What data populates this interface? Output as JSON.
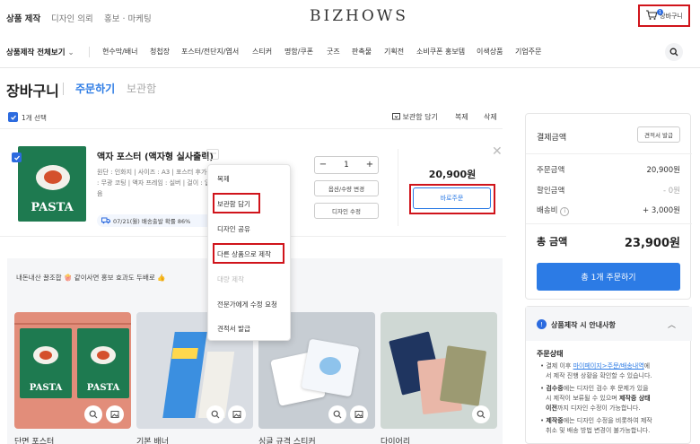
{
  "top_nav": {
    "links": [
      "상품 제작",
      "디자인 의뢰",
      "홍보 · 마케팅"
    ],
    "logo": "BIZHOWS",
    "cart_label": "장바구니",
    "cart_count": "1"
  },
  "category_nav": {
    "all_label": "상품제작 전체보기",
    "items": [
      "현수막/배너",
      "청첩장",
      "포스터/전단지/엽서",
      "스티커",
      "명함/쿠폰",
      "굿즈",
      "판촉물",
      "기획전",
      "소비쿠폰 홍보템",
      "이색상품",
      "기업주문"
    ]
  },
  "page": {
    "title": "장바구니",
    "tabs": [
      "주문하기",
      "보관함"
    ]
  },
  "selection": {
    "label": "1개 선택",
    "actions": [
      "보관함 담기",
      "복제",
      "삭제"
    ]
  },
  "cart_item": {
    "name": "액자 포스터 (액자형 실사출력)",
    "more": "···",
    "options": "원단 : 인화지 | 사이즈 : A3 | 포스터 후가공 : 무광 코팅 | 액자 프레임 : 실버 | 걸이 : 없음",
    "thumb_text": "PASTA",
    "shipping": "07/21(월) 배송출발 확률 86%",
    "quantity": "1",
    "qty_minus": "−",
    "qty_plus": "+",
    "btn_change": "옵션/수량 변경",
    "btn_edit": "디자인 수정",
    "price": "20,900원",
    "buy_now": "바로주문",
    "close": "✕"
  },
  "dropdown_menu": {
    "items": [
      "복제",
      "보관함 담기",
      "디자인 공유",
      "다른 상품으로 제작",
      "대량 제작",
      "전문가에게 수정 요청",
      "견적서 발급"
    ]
  },
  "promo": {
    "text": "내돈내산 꿀조합 🍿 같이사면 홍보 효과도 두배로 👍",
    "cards": [
      "단면 포스터",
      "기본 배너",
      "싱글 규격 스티커",
      "다이어리"
    ],
    "poster_text": "PASTA"
  },
  "summary": {
    "title": "결제금액",
    "quote_btn": "견적서 발급",
    "rows": [
      {
        "label": "주문금액",
        "value": "20,900원"
      },
      {
        "label": "할인금액",
        "value": "- 0원"
      },
      {
        "label": "배송비",
        "value": "+ 3,000원"
      }
    ],
    "total_label": "총 금액",
    "total_value": "23,900원",
    "order_button": "총 1개 주문하기"
  },
  "guide": {
    "title": "상품제작 시 안내사항",
    "subtitle": "주문상태",
    "lines": [
      {
        "pre": "결제 이후 ",
        "link": "마이페이지>주문/배송내역",
        "post": "에"
      },
      {
        "pre": "서 제작 진행 상황을 확인할 수 있습니다.",
        "link": "",
        "post": ""
      },
      {
        "pre": "검수중",
        "link": "",
        "post": "에는 디자인 검수 후 문제가 있을"
      },
      {
        "pre": "시 제작이 보류될 수 있으며 ",
        "link": "",
        "post": "제작중 상태"
      },
      {
        "pre": "이전",
        "link": "",
        "post": "까지 디자인 수정이 가능합니다."
      },
      {
        "pre": "제작중",
        "link": "",
        "post": "에는 디자인 수정을 비롯하여 제작"
      },
      {
        "pre": "취소 및 배송 방법 변경이 불가능합니다.",
        "link": "",
        "post": ""
      }
    ]
  },
  "colors": {
    "accent": "#2c7be5",
    "highlight": "#d0141b",
    "poster_green": "#1e7a50"
  }
}
